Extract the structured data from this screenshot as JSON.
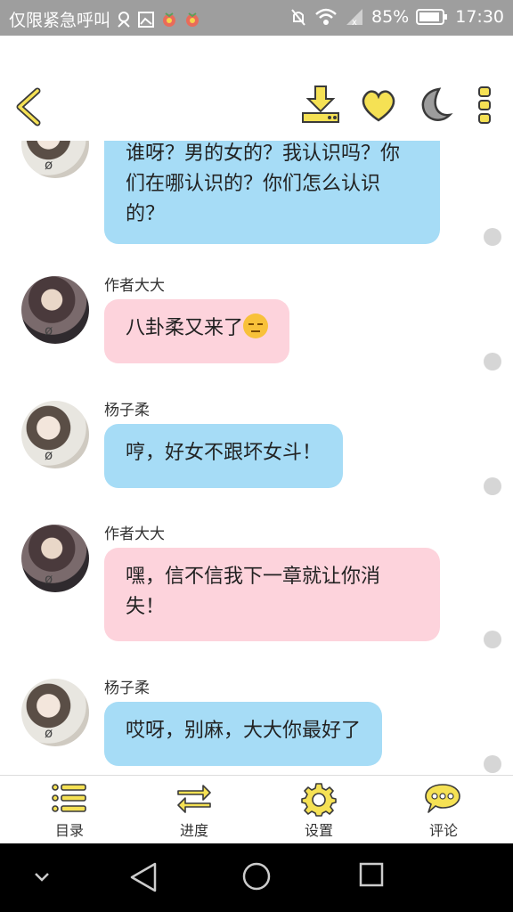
{
  "status_bar": {
    "left_text": "仅限紧急呼叫",
    "battery": "85%",
    "time": "17:30",
    "icons": [
      "mask-icon",
      "image-icon",
      "app-icon",
      "app-icon",
      "mute-icon",
      "wifi-icon",
      "signal-icon",
      "battery-icon"
    ]
  },
  "header": {
    "icons": [
      "back-arrow-icon",
      "download-icon",
      "heart-icon",
      "night-mode-icon",
      "more-vertical-icon"
    ],
    "accent_color": "#f5e154"
  },
  "chat": {
    "messages": [
      {
        "sender": "",
        "text": "谁呀？男的女的？我认识吗？你们在哪认识的？你们怎么认识的？",
        "style": "blue",
        "avatar": "yang"
      },
      {
        "sender": "作者大大",
        "text": "八卦柔又来了",
        "style": "pink",
        "avatar": "author",
        "emoji": "unamused-face"
      },
      {
        "sender": "杨子柔",
        "text": "哼，好女不跟坏女斗！",
        "style": "blue",
        "avatar": "yang"
      },
      {
        "sender": "作者大大",
        "text": "嘿，信不信我下一章就让你消失！",
        "style": "pink",
        "avatar": "author"
      },
      {
        "sender": "杨子柔",
        "text": "哎呀，别麻，大大你最好了",
        "style": "blue",
        "avatar": "yang"
      }
    ],
    "avatar_mark": "ø",
    "colors": {
      "blue_bubble": "#a6dcf6",
      "pink_bubble": "#fdd3dc"
    }
  },
  "tabbar": {
    "tabs": [
      {
        "label": "目录",
        "icon": "list-icon"
      },
      {
        "label": "进度",
        "icon": "progress-arrows-icon"
      },
      {
        "label": "设置",
        "icon": "gear-icon"
      },
      {
        "label": "评论",
        "icon": "comment-icon"
      }
    ]
  },
  "nav_bar": {
    "icons": [
      "chevron-down-icon",
      "back-triangle-icon",
      "home-circle-icon",
      "recents-square-icon"
    ]
  }
}
